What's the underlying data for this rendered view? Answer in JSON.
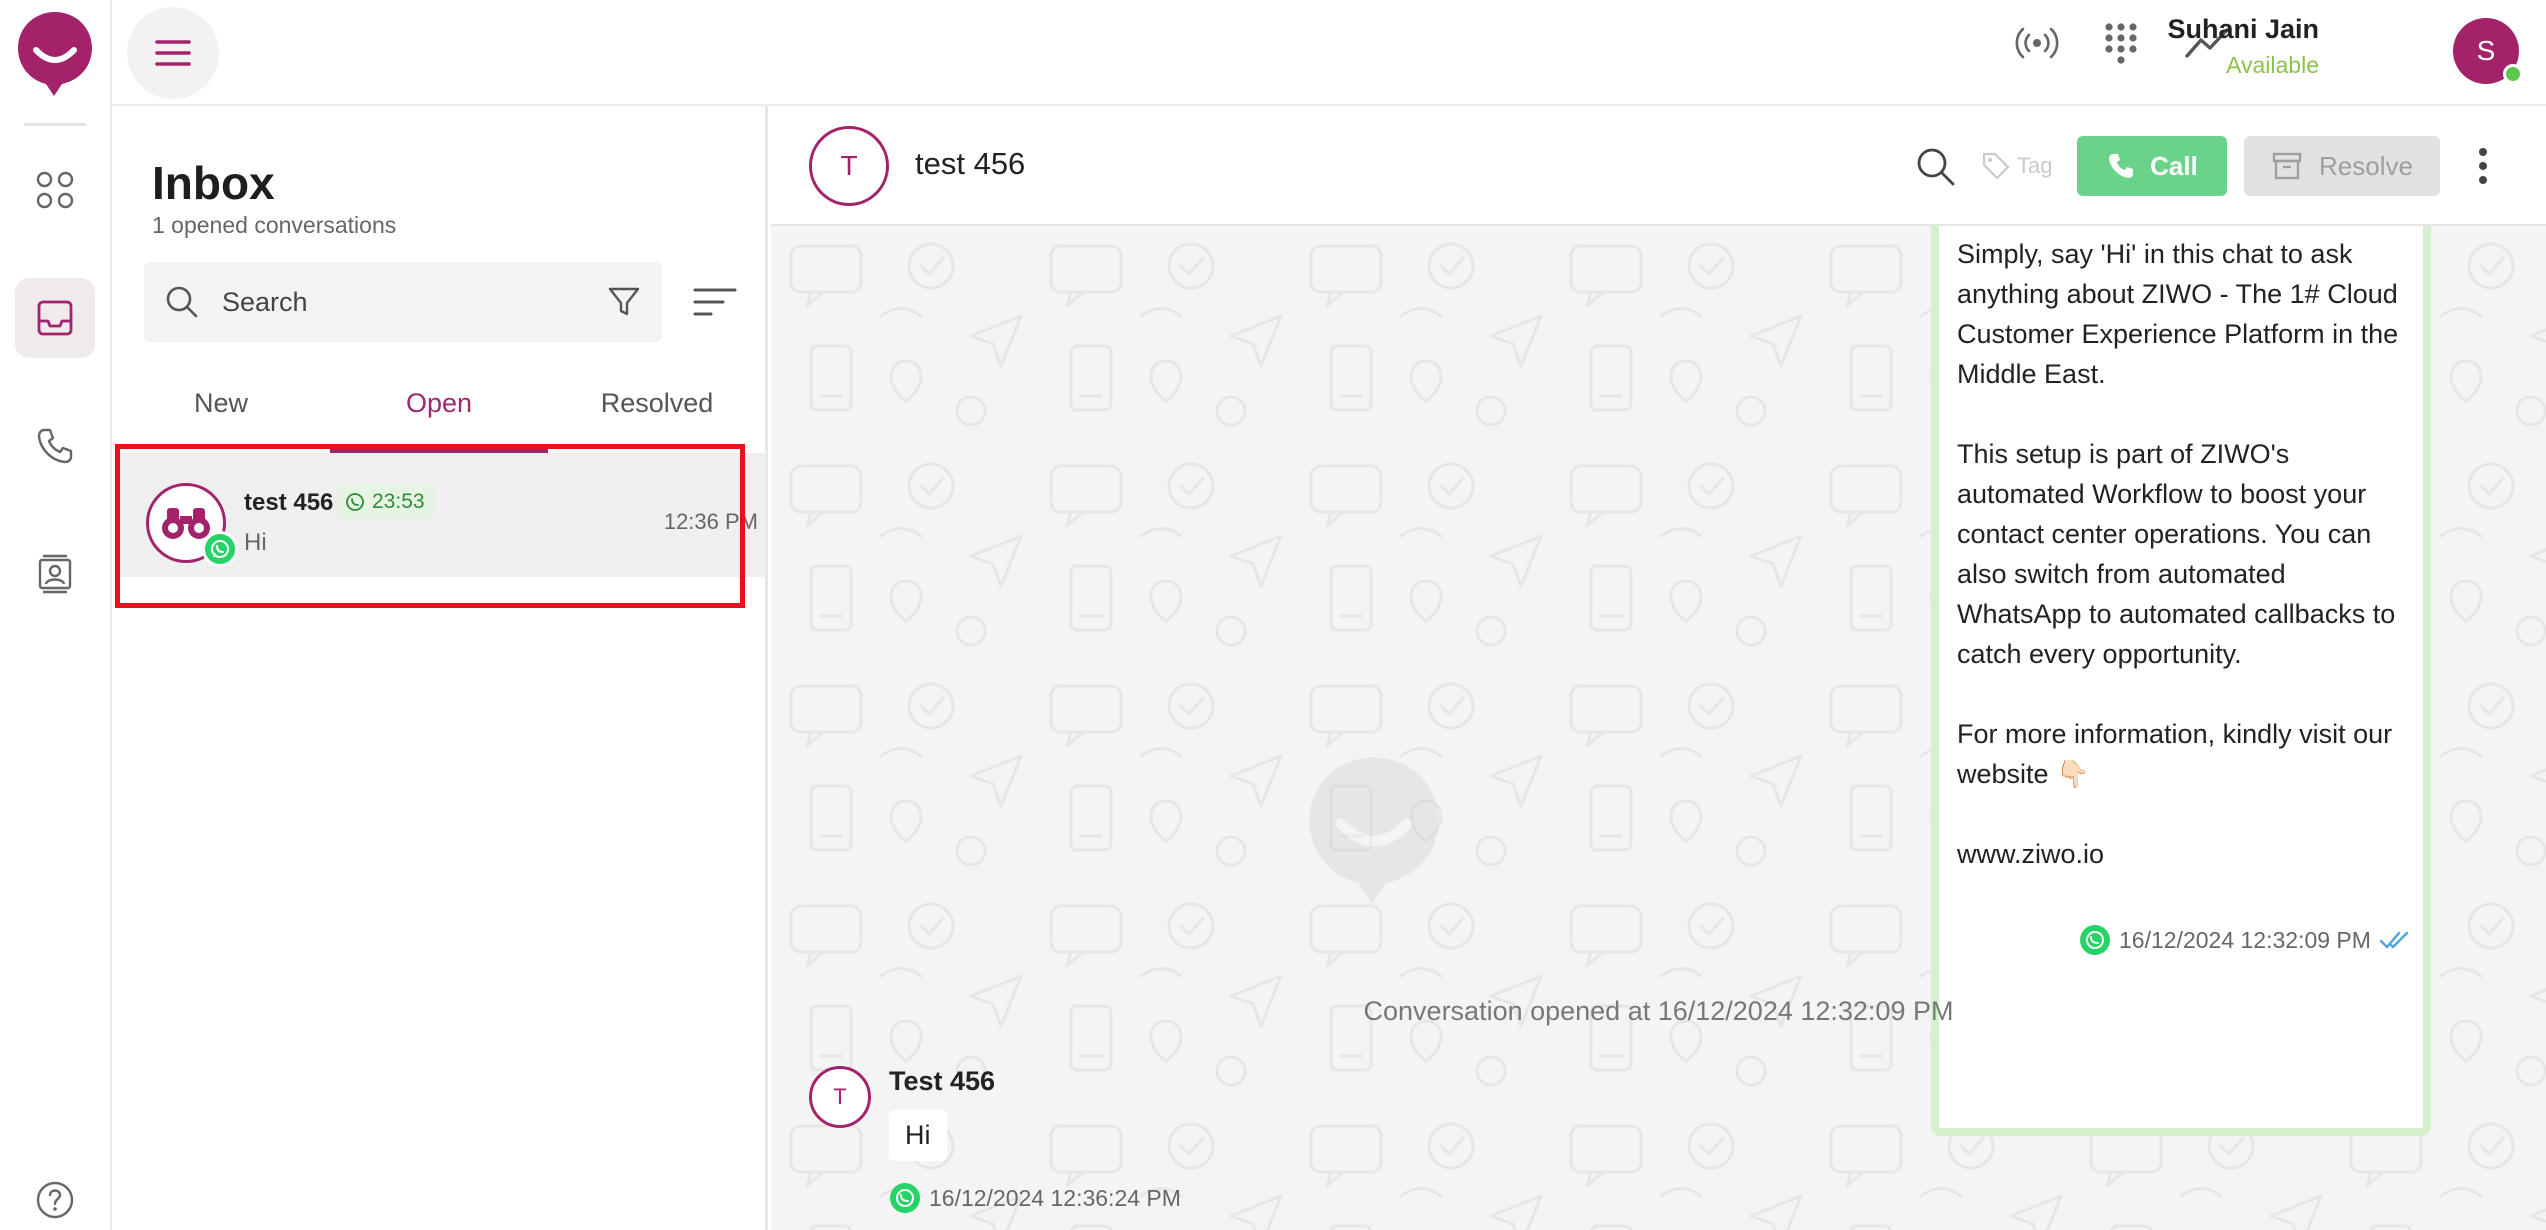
{
  "app": {
    "brand_color": "#a3236b",
    "accent_green": "#6bd28a"
  },
  "topbar": {
    "menu_icon": "hamburger-icon",
    "icons": [
      "broadcast-icon",
      "dialpad-icon",
      "trend-icon"
    ],
    "user": {
      "name": "Suhani Jain",
      "status": "Available",
      "initial": "S",
      "status_color": "#8bc34a"
    }
  },
  "rail": {
    "items": [
      {
        "name": "apps-icon"
      },
      {
        "name": "inbox-icon",
        "active": true
      },
      {
        "name": "phone-icon"
      },
      {
        "name": "contacts-icon"
      }
    ],
    "help_icon": "help-icon"
  },
  "inbox": {
    "title": "Inbox",
    "subtitle": "1 opened conversations",
    "search_placeholder": "Search",
    "tabs": [
      {
        "label": "New"
      },
      {
        "label": "Open",
        "active": true
      },
      {
        "label": "Resolved"
      }
    ],
    "conversations": [
      {
        "name": "test 456",
        "timer": "23:53",
        "preview": "Hi",
        "time": "12:36 PM",
        "channel": "whatsapp"
      }
    ]
  },
  "chat": {
    "contact_initial": "T",
    "contact_name": "test 456",
    "tag_label": "Tag",
    "call_label": "Call",
    "resolve_label": "Resolve",
    "outgoing": {
      "paragraphs": [
        "Simply, say 'Hi' in this chat to ask anything about ZIWO - The 1# Cloud Customer Experience Platform in the Middle East.",
        "This setup is part of ZIWO's automated Workflow to boost your contact center operations. You can also switch from automated WhatsApp to automated callbacks to catch every opportunity.",
        "For more information, kindly visit our website 👇🏻",
        "www.ziwo.io"
      ],
      "timestamp": "16/12/2024 12:32:09 PM"
    },
    "system_message": "Conversation opened at 16/12/2024 12:32:09 PM",
    "incoming": {
      "initial": "T",
      "sender": "Test 456",
      "text": "Hi",
      "timestamp": "16/12/2024 12:36:24 PM"
    }
  }
}
